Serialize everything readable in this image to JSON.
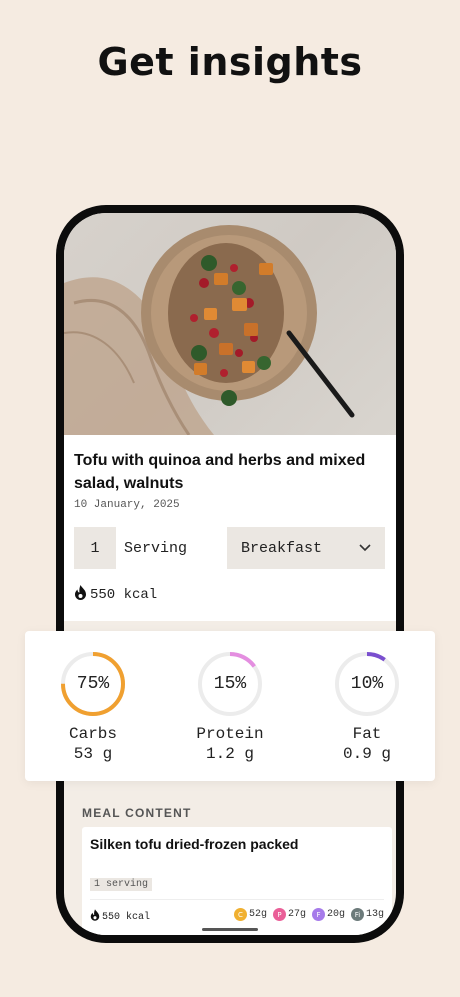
{
  "headline": "Get insights",
  "food": {
    "title": "Tofu with quinoa and herbs and mixed salad, walnuts",
    "date": "10 January, 2025",
    "quantity": "1",
    "serving_label": "Serving",
    "meal": "Breakfast",
    "kcal": "550 kcal"
  },
  "macros": [
    {
      "name": "Carbs",
      "percent": "75%",
      "fraction": 0.75,
      "amount": "53 g",
      "color": "#f0a030"
    },
    {
      "name": "Protein",
      "percent": "15%",
      "fraction": 0.15,
      "amount": "1.2 g",
      "color": "#e48ee0"
    },
    {
      "name": "Fat",
      "percent": "10%",
      "fraction": 0.1,
      "amount": "0.9 g",
      "color": "#7a4fcf"
    }
  ],
  "meal_content": {
    "heading": "MEAL CONTENT",
    "item": {
      "name": "Silken tofu dried-frozen packed",
      "serving": "1 serving",
      "kcal": "550 kcal",
      "macros": [
        {
          "letter": "C",
          "value": "52g",
          "color": "#f0b030"
        },
        {
          "letter": "P",
          "value": "27g",
          "color": "#ea5f98"
        },
        {
          "letter": "F",
          "value": "20g",
          "color": "#a67bea"
        },
        {
          "letter": "Fi",
          "value": "13g",
          "color": "#6c7a7a"
        }
      ]
    }
  },
  "icons": {
    "kcal": "flame-icon",
    "meal_dropdown": "chevron-down-icon"
  }
}
